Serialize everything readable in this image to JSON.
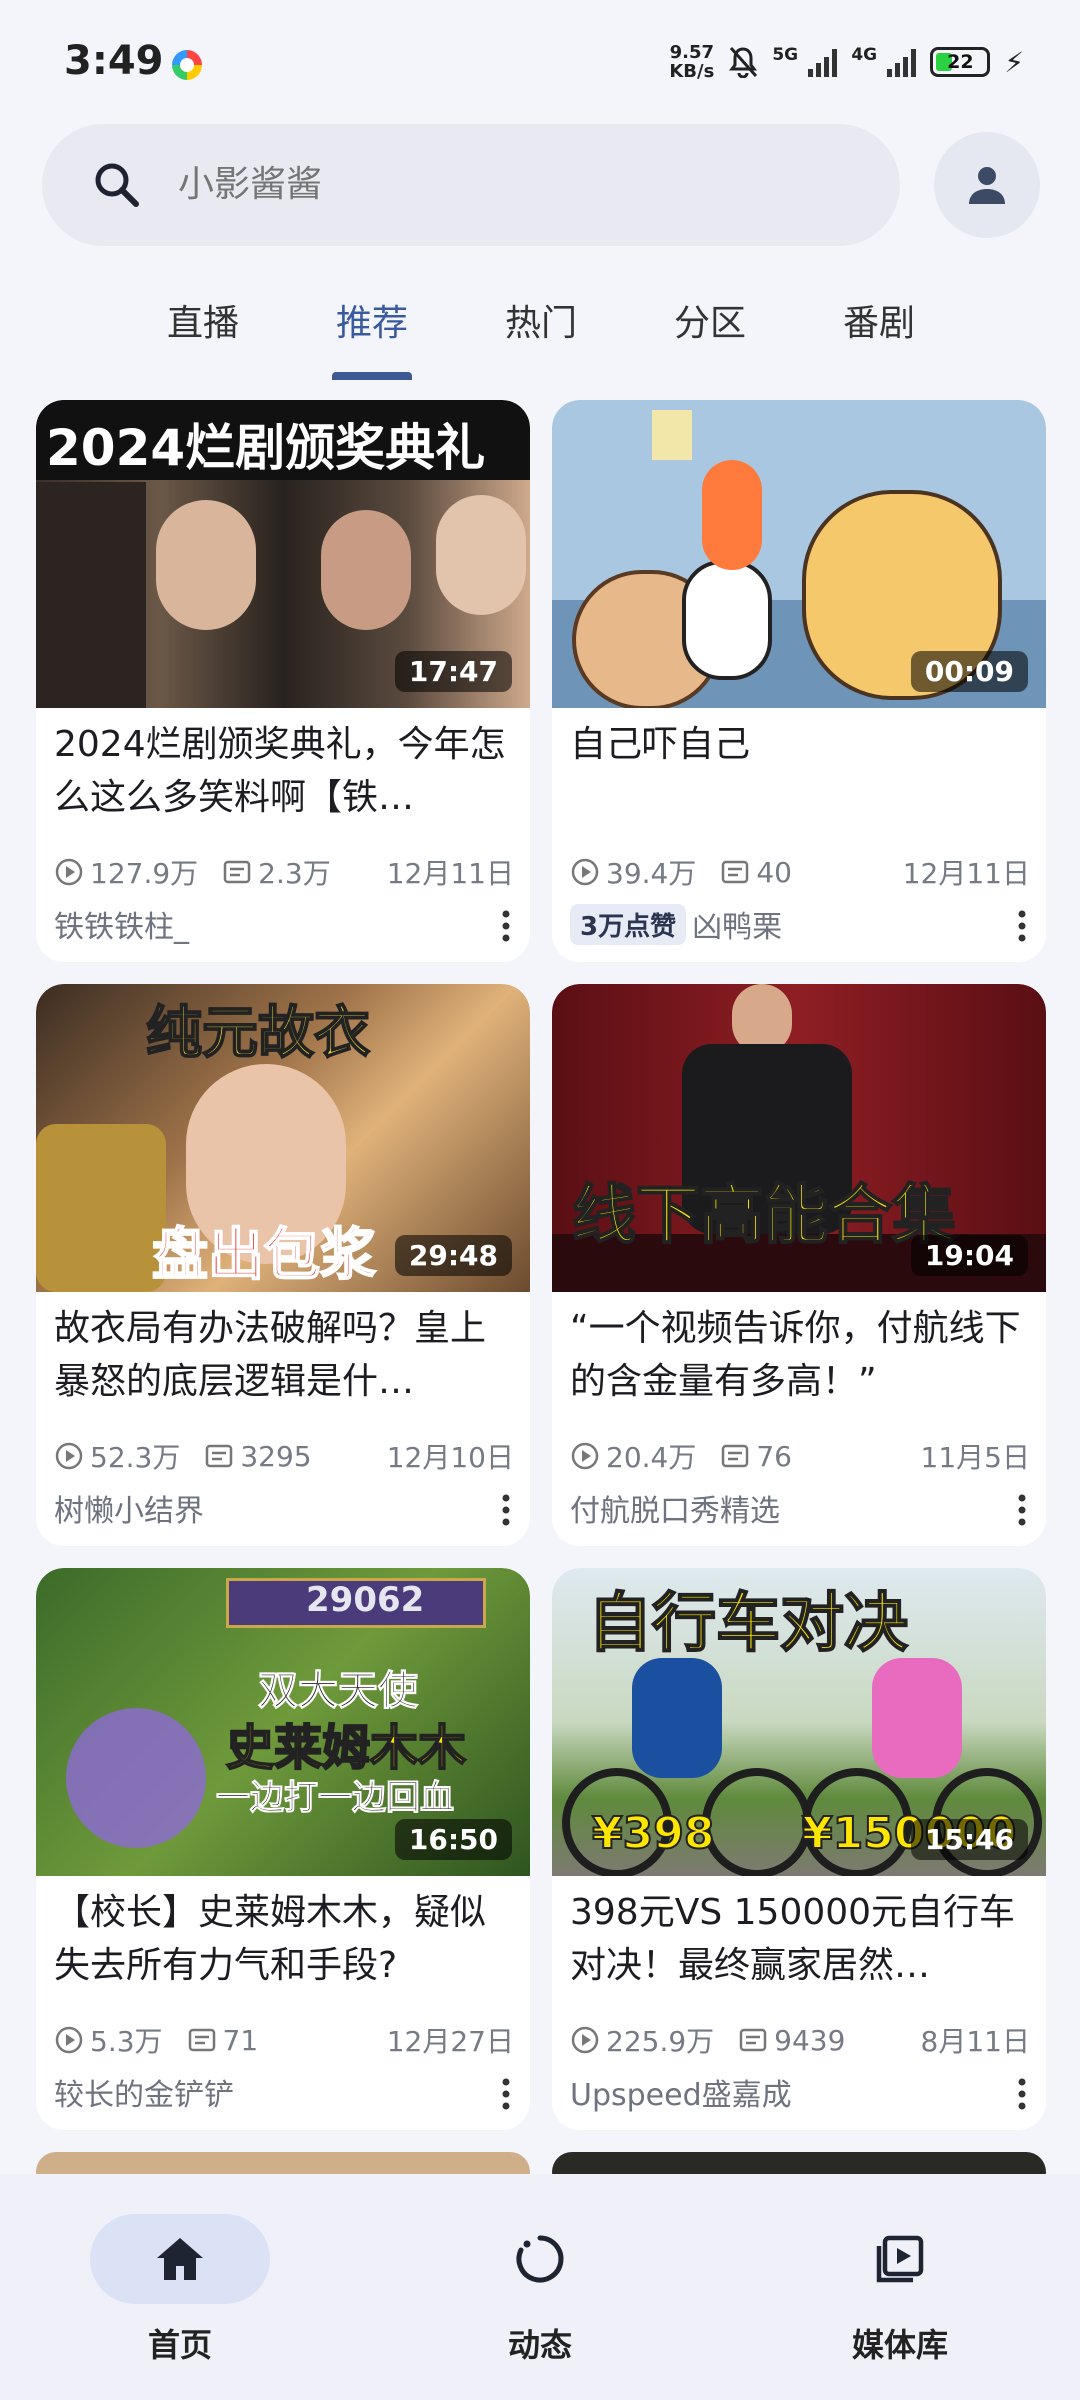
{
  "status": {
    "time": "3:49",
    "net_speed_value": "9.57",
    "net_speed_unit": "KB/s",
    "sig1": "5G",
    "sig2": "4G",
    "battery": "22"
  },
  "search": {
    "placeholder": "小影酱酱"
  },
  "tabs": [
    {
      "label": "直播",
      "active": false
    },
    {
      "label": "推荐",
      "active": true
    },
    {
      "label": "热门",
      "active": false
    },
    {
      "label": "分区",
      "active": false
    },
    {
      "label": "番剧",
      "active": false
    }
  ],
  "videos": [
    {
      "title": "2024烂剧颁奖典礼，今年怎么这么多笑料啊【铁…",
      "duration": "17:47",
      "views": "127.9万",
      "danmaku": "2.3万",
      "date": "12月11日",
      "author": "铁铁铁柱_",
      "badge": "",
      "thumb_text": "2024烂剧颁奖典礼"
    },
    {
      "title": "自己吓自己",
      "duration": "00:09",
      "views": "39.4万",
      "danmaku": "40",
      "date": "12月11日",
      "author": "凶鸭栗",
      "badge": "3万点赞",
      "thumb_text": ""
    },
    {
      "title": "故衣局有办法破解吗？皇上暴怒的底层逻辑是什…",
      "duration": "29:48",
      "views": "52.3万",
      "danmaku": "3295",
      "date": "12月10日",
      "author": "树懒小结界",
      "badge": "",
      "thumb_text": "纯元故衣",
      "thumb_text2": "盘出包浆"
    },
    {
      "title": "“一个视频告诉你，付航线下的含金量有多高！”",
      "duration": "19:04",
      "views": "20.4万",
      "danmaku": "76",
      "date": "11月5日",
      "author": "付航脱口秀精选",
      "badge": "",
      "thumb_text": "线下高能合集"
    },
    {
      "title": "【校长】史莱姆木木，疑似失去所有力气和手段?",
      "duration": "16:50",
      "views": "5.3万",
      "danmaku": "71",
      "date": "12月27日",
      "author": "较长的金铲铲",
      "badge": "",
      "thumb_text": "双大天使",
      "thumb_text2": "史莱姆木木",
      "thumb_text3": "一边打一边回血",
      "thumb_num": "29062"
    },
    {
      "title": "398元VS 150000元自行车对决！最终赢家居然…",
      "duration": "15:46",
      "views": "225.9万",
      "danmaku": "9439",
      "date": "8月11日",
      "author": "Upspeed盛嘉成",
      "badge": "",
      "thumb_text": "自行车对决",
      "thumb_text2": "¥398",
      "thumb_text3": "¥150000"
    }
  ],
  "nav": [
    {
      "label": "首页",
      "icon": "home-icon",
      "active": true
    },
    {
      "label": "动态",
      "icon": "activity-icon",
      "active": false
    },
    {
      "label": "媒体库",
      "icon": "library-icon",
      "active": false
    }
  ]
}
